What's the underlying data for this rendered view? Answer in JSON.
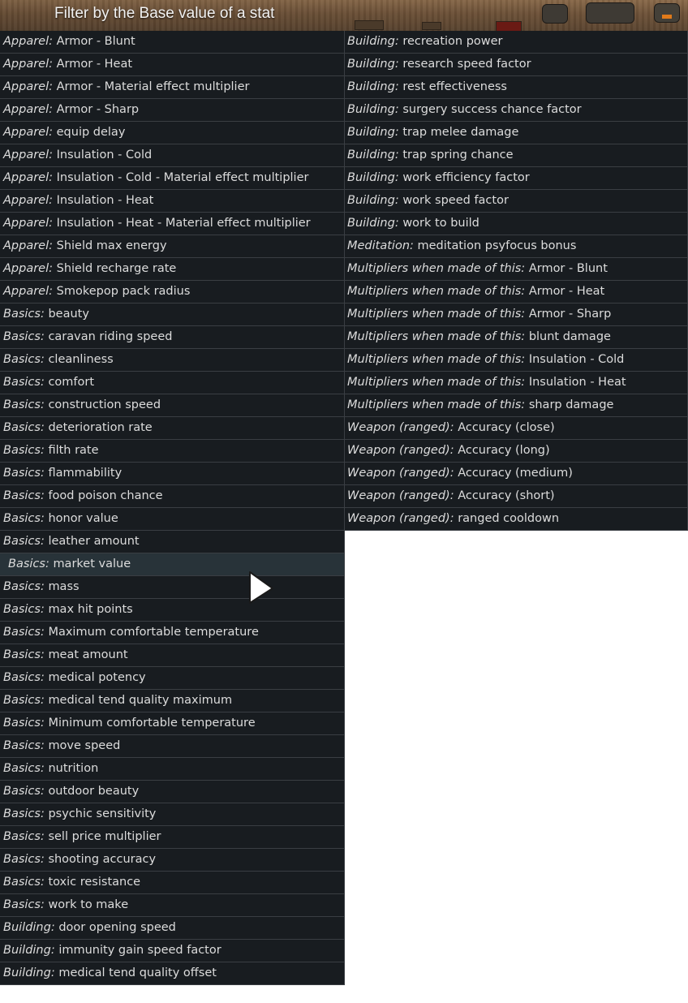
{
  "header": {
    "title": "Filter by the Base value of a stat"
  },
  "icons": {
    "cursor": "arrow-cursor-icon",
    "header_right": "colony-icon"
  },
  "colors": {
    "row_bg": "#181c20",
    "row_highlight_bg": "#283339",
    "row_border": "#3a3e43",
    "text": "#dcdcdc"
  },
  "left_column": [
    {
      "category": "Apparel:",
      "stat": "Armor - Blunt"
    },
    {
      "category": "Apparel:",
      "stat": "Armor - Heat"
    },
    {
      "category": "Apparel:",
      "stat": "Armor - Material effect multiplier"
    },
    {
      "category": "Apparel:",
      "stat": "Armor - Sharp"
    },
    {
      "category": "Apparel:",
      "stat": "equip delay"
    },
    {
      "category": "Apparel:",
      "stat": "Insulation - Cold"
    },
    {
      "category": "Apparel:",
      "stat": "Insulation - Cold - Material effect multiplier"
    },
    {
      "category": "Apparel:",
      "stat": "Insulation - Heat"
    },
    {
      "category": "Apparel:",
      "stat": "Insulation - Heat - Material effect multiplier"
    },
    {
      "category": "Apparel:",
      "stat": "Shield max energy"
    },
    {
      "category": "Apparel:",
      "stat": "Shield recharge rate"
    },
    {
      "category": "Apparel:",
      "stat": "Smokepop pack radius"
    },
    {
      "category": "Basics:",
      "stat": "beauty"
    },
    {
      "category": "Basics:",
      "stat": "caravan riding speed"
    },
    {
      "category": "Basics:",
      "stat": "cleanliness"
    },
    {
      "category": "Basics:",
      "stat": "comfort"
    },
    {
      "category": "Basics:",
      "stat": "construction speed"
    },
    {
      "category": "Basics:",
      "stat": "deterioration rate"
    },
    {
      "category": "Basics:",
      "stat": "filth rate"
    },
    {
      "category": "Basics:",
      "stat": "flammability"
    },
    {
      "category": "Basics:",
      "stat": "food poison chance"
    },
    {
      "category": "Basics:",
      "stat": "honor value"
    },
    {
      "category": "Basics:",
      "stat": "leather amount"
    },
    {
      "category": "Basics:",
      "stat": "market value"
    },
    {
      "category": "Basics:",
      "stat": "mass"
    },
    {
      "category": "Basics:",
      "stat": "max hit points"
    },
    {
      "category": "Basics:",
      "stat": "Maximum comfortable temperature"
    },
    {
      "category": "Basics:",
      "stat": "meat amount"
    },
    {
      "category": "Basics:",
      "stat": "medical potency"
    },
    {
      "category": "Basics:",
      "stat": "medical tend quality maximum"
    },
    {
      "category": "Basics:",
      "stat": "Minimum comfortable temperature"
    },
    {
      "category": "Basics:",
      "stat": "move speed"
    },
    {
      "category": "Basics:",
      "stat": "nutrition"
    },
    {
      "category": "Basics:",
      "stat": "outdoor beauty"
    },
    {
      "category": "Basics:",
      "stat": "psychic sensitivity"
    },
    {
      "category": "Basics:",
      "stat": "sell price multiplier"
    },
    {
      "category": "Basics:",
      "stat": "shooting accuracy"
    },
    {
      "category": "Basics:",
      "stat": "toxic resistance"
    },
    {
      "category": "Basics:",
      "stat": "work to make"
    },
    {
      "category": "Building:",
      "stat": "door opening speed"
    },
    {
      "category": "Building:",
      "stat": "immunity gain speed factor"
    },
    {
      "category": "Building:",
      "stat": "medical tend quality offset"
    }
  ],
  "right_column": [
    {
      "category": "Building:",
      "stat": "recreation power"
    },
    {
      "category": "Building:",
      "stat": "research speed factor"
    },
    {
      "category": "Building:",
      "stat": "rest effectiveness"
    },
    {
      "category": "Building:",
      "stat": "surgery success chance factor"
    },
    {
      "category": "Building:",
      "stat": "trap melee damage"
    },
    {
      "category": "Building:",
      "stat": "trap spring chance"
    },
    {
      "category": "Building:",
      "stat": "work efficiency factor"
    },
    {
      "category": "Building:",
      "stat": "work speed factor"
    },
    {
      "category": "Building:",
      "stat": "work to build"
    },
    {
      "category": "Meditation:",
      "stat": "meditation psyfocus bonus"
    },
    {
      "category": "Multipliers when made of this:",
      "stat": "Armor - Blunt"
    },
    {
      "category": "Multipliers when made of this:",
      "stat": "Armor - Heat"
    },
    {
      "category": "Multipliers when made of this:",
      "stat": "Armor - Sharp"
    },
    {
      "category": "Multipliers when made of this:",
      "stat": "blunt damage"
    },
    {
      "category": "Multipliers when made of this:",
      "stat": "Insulation - Cold"
    },
    {
      "category": "Multipliers when made of this:",
      "stat": "Insulation - Heat"
    },
    {
      "category": "Multipliers when made of this:",
      "stat": "sharp damage"
    },
    {
      "category": "Weapon (ranged):",
      "stat": "Accuracy (close)"
    },
    {
      "category": "Weapon (ranged):",
      "stat": "Accuracy (long)"
    },
    {
      "category": "Weapon (ranged):",
      "stat": "Accuracy (medium)"
    },
    {
      "category": "Weapon (ranged):",
      "stat": "Accuracy (short)"
    },
    {
      "category": "Weapon (ranged):",
      "stat": "ranged cooldown"
    }
  ],
  "highlighted_item": "left_column.23"
}
